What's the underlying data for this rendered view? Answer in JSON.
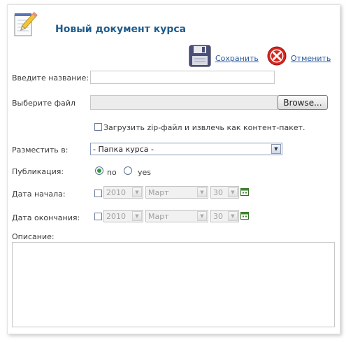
{
  "header": {
    "title": "Новый документ курса",
    "icon": "notepad-pencil-icon"
  },
  "toolbar": {
    "save_label": "Сохранить",
    "save_icon": "floppy-disk-icon",
    "cancel_label": "Отменить",
    "cancel_icon": "cancel-x-icon"
  },
  "form": {
    "name_label": "Введите название:",
    "name_value": "",
    "file_label": "Выберите файл",
    "browse_label": "Browse...",
    "zip_label": "Загрузить zip-файл и извлечь как контент-пакет.",
    "place_label": "Разместить в:",
    "place_value": "- Папка курса -",
    "publication_label": "Публикация:",
    "publication_options": [
      "no",
      "yes"
    ],
    "publication_selected": "no",
    "start_label": "Дата начала:",
    "start_year": "2010",
    "start_month": "Март",
    "start_day": "30",
    "end_label": "Дата окончания:",
    "end_year": "2010",
    "end_month": "Март",
    "end_day": "30",
    "description_label": "Описание:",
    "description_value": ""
  },
  "colors": {
    "title": "#1f5c8c",
    "link": "#2a5b9f",
    "cancel_red": "#d8261e",
    "radio_selected": "#2a9a3a"
  }
}
